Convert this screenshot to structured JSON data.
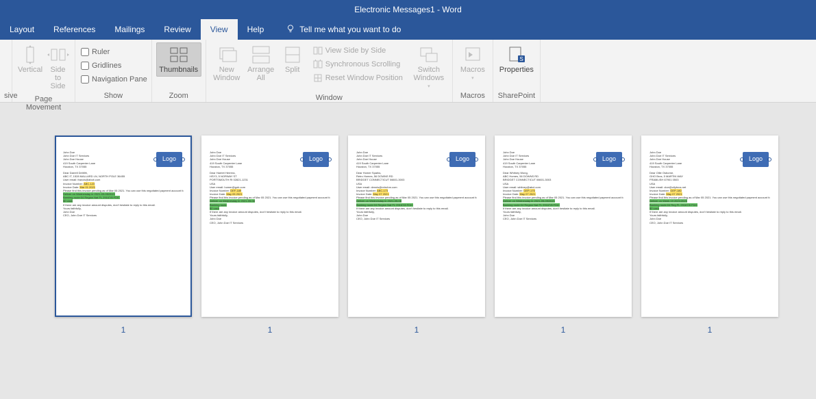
{
  "title": "Electronic Messages1  -  Word",
  "menu": {
    "layout": "Layout",
    "references": "References",
    "mailings": "Mailings",
    "review": "Review",
    "view": "View",
    "help": "Help",
    "tellme": "Tell me what you want to do"
  },
  "ribbon": {
    "immersive": {
      "group": "sive"
    },
    "pagemove": {
      "vertical": "Vertical",
      "side": "Side\nto Side",
      "group": "Page Movement"
    },
    "show": {
      "ruler": "Ruler",
      "gridlines": "Gridlines",
      "navpane": "Navigation Pane",
      "group": "Show"
    },
    "zoom": {
      "thumbnails": "Thumbnails",
      "group": "Zoom"
    },
    "window": {
      "newwin": "New\nWindow",
      "arrange": "Arrange\nAll",
      "split": "Split",
      "sidebyside": "View Side by Side",
      "sync": "Synchronous Scrolling",
      "reset": "Reset Window Position",
      "switch": "Switch\nWindows",
      "group": "Window"
    },
    "macros": {
      "macros": "Macros",
      "group": "Macros"
    },
    "sharepoint": {
      "properties": "Properties",
      "group": "SharePoint"
    }
  },
  "thumbs": [
    {
      "selected": true,
      "lines": [
        {
          "t": "John Doe"
        },
        {
          "t": "John Doe IT Services"
        },
        {
          "t": "John Doe House"
        },
        {
          "t": "419 South Carpenter Lane"
        },
        {
          "t": "Houston, TX 37055"
        },
        {
          "gap": true
        },
        {
          "t": "Dear Darrell DeWitt,"
        },
        {
          "t": "ABC IT, 1528 MALLARD LN, NORTH POLE 36455"
        },
        {
          "t": "User email: francis@abcit.com"
        },
        {
          "t": "Invoice Number: ",
          "hl": "y",
          "ht": "ABC-123"
        },
        {
          "t": "Invoice Date: ",
          "hl": "y",
          "ht": "Mar 01 2021"
        },
        {
          "t": "Please find this invoice pending as of Mar 05 2021. You can use this negotiated payment account for post-invoice amount."
        },
        {
          "full": "g",
          "ht": "Deliver on Wednesday in 2021-03-05/2021"
        },
        {
          "full": "g",
          "ht": "Banking route:04 Region Nat FL 29167/8 FDIC"
        },
        {
          "full": "g",
          "ht": "$0 cash"
        },
        {
          "t": "If there are any invoice amount disputes, don't hesitate to reply to this email."
        },
        {
          "t": "Yours faithfully,"
        },
        {
          "t": "John Doe"
        },
        {
          "t": "CEO, John Doe IT Services"
        }
      ],
      "pagenum": "1"
    },
    {
      "selected": false,
      "lines": [
        {
          "t": "John Doe"
        },
        {
          "t": "John Doe IT Services"
        },
        {
          "t": "John Doe House"
        },
        {
          "t": "419 South Carpenter Lane"
        },
        {
          "t": "Houston, TX 37055"
        },
        {
          "gap": true
        },
        {
          "t": "Dear Harriet Herrera,"
        },
        {
          "t": "HSY3, 5 NORWAY ST"
        },
        {
          "t": "PORTSMOUTH RI 02821-1231"
        },
        {
          "t": "USA"
        },
        {
          "t": "User email: homer@gob.com"
        },
        {
          "t": "Invoice Number: ",
          "hl": "y",
          "ht": "DEF-189"
        },
        {
          "t": "Invoice Date: ",
          "hl": "y",
          "ht": "May 05 2021"
        },
        {
          "t": "Please find this invoice pending as of Mar 05 2021. You can use this negotiated payment account for post-invoice amount."
        },
        {
          "full": "g",
          "ht": "Deliver on Wednesday in 2021-05-08"
        },
        {
          "full": "g",
          "ht": "Banking route"
        },
        {
          "full": "g",
          "ht": "$0 cash"
        },
        {
          "t": "If there are any invoice amount disputes, don't hesitate to reply to this email."
        },
        {
          "t": "Yours faithfully,"
        },
        {
          "t": "John Doe"
        },
        {
          "t": "CEO, John Doe IT Services"
        }
      ],
      "pagenum": "1"
    },
    {
      "selected": false,
      "lines": [
        {
          "t": "John Doe"
        },
        {
          "t": "John Doe IT Services"
        },
        {
          "t": "John Doe House"
        },
        {
          "t": "419 South Carpenter Lane"
        },
        {
          "t": "Houston, TX 37055"
        },
        {
          "gap": true
        },
        {
          "t": "Dear Homer Sparks,"
        },
        {
          "t": "Retro Homes, 56 DOWNS RD"
        },
        {
          "t": "BRIDGET CONNECTICUT 06601-3003"
        },
        {
          "t": "USA"
        },
        {
          "t": "User email: dennis@retrohm.com"
        },
        {
          "t": "Invoice Number: ",
          "hl": "y",
          "ht": "ABC-173"
        },
        {
          "t": "Invoice Date: ",
          "hl": "y",
          "ht": "May 07 2021"
        },
        {
          "t": "Please find this invoice pending as of Mar 05 2021. You can use this negotiated payment account for post-invoice amount."
        },
        {
          "full": "g",
          "ht": "Deliver on Wednesday in 2021-05-08"
        },
        {
          "full": "g",
          "ht": "Banking route:04 Region Nat FL 29167/8 FDIC"
        },
        {
          "t": "If there are any invoice amount disputes, don't hesitate to reply to this email."
        },
        {
          "t": "Yours faithfully,"
        },
        {
          "t": "John Doe"
        },
        {
          "t": "CEO, John Doe IT Services"
        }
      ],
      "pagenum": "1"
    },
    {
      "selected": false,
      "lines": [
        {
          "t": "John Doe"
        },
        {
          "t": "John Doe IT Services"
        },
        {
          "t": "John Doe House"
        },
        {
          "t": "419 South Carpenter Lane"
        },
        {
          "t": "Houston, TX 37055"
        },
        {
          "gap": true
        },
        {
          "t": "Dear Whitney Wong,"
        },
        {
          "t": "ABC Homes, 56 DOWNS RD"
        },
        {
          "t": "BRIDGET CONNECTICUT 06601-3003"
        },
        {
          "t": "USA"
        },
        {
          "t": "User email: whitney@abcl.com"
        },
        {
          "t": "Invoice Number: ",
          "hl": "y",
          "ht": "GEP-175"
        },
        {
          "t": "Invoice Date: ",
          "hl": "y",
          "ht": "May 07 2021"
        },
        {
          "t": "Please find this invoice pending as of Mar 05 2021. You can use this negotiated payment account for post-invoice amount."
        },
        {
          "full": "g",
          "ht": "Deliver on Wednesday in 2021-05-09/2021"
        },
        {
          "full": "g",
          "ht": "Banking route:04 Region Nat FL 29167/8 FDIC"
        },
        {
          "t": "If there are any invoice amount disputes, don't hesitate to reply to this email."
        },
        {
          "t": "Yours faithfully,"
        },
        {
          "t": "John Doe"
        },
        {
          "t": "CEO, John Doe IT Services"
        }
      ],
      "pagenum": "1"
    },
    {
      "selected": false,
      "lines": [
        {
          "t": "John Doe"
        },
        {
          "t": "John Doe IT Services"
        },
        {
          "t": "John Doe House"
        },
        {
          "t": "419 South Carpenter Lane"
        },
        {
          "t": "Houston, TX 37055"
        },
        {
          "gap": true
        },
        {
          "t": "Dear Ollie Osborne,"
        },
        {
          "t": "GHO Bros, 5 MARTIN WAY"
        },
        {
          "t": "FRAMLISH 67901 0503"
        },
        {
          "t": "USA"
        },
        {
          "t": "User email: cloe@ollybros.net"
        },
        {
          "t": "Invoice Number: ",
          "hl": "y",
          "ht": "GEP-180"
        },
        {
          "t": "Invoice Date: ",
          "hl": "y",
          "ht": "May 07 2021"
        },
        {
          "t": "Please find this invoice pending as of Mar 05 2021. You can use this negotiated payment account for post-invoice amount."
        },
        {
          "full": "g",
          "ht": "Deliver on Week 19 2021/2025"
        },
        {
          "full": "g",
          "ht": "Banking route:04 Reg FL 29167/8 FDIC"
        },
        {
          "full": "g",
          "ht": "$0 cash"
        },
        {
          "t": "If there are any invoice amount disputes, don't hesitate to reply to this email."
        },
        {
          "t": "Yours faithfully,"
        },
        {
          "t": "John Doe"
        },
        {
          "t": "CEO, John Doe IT Services"
        }
      ],
      "pagenum": "1"
    }
  ],
  "logo_text": "Logo"
}
